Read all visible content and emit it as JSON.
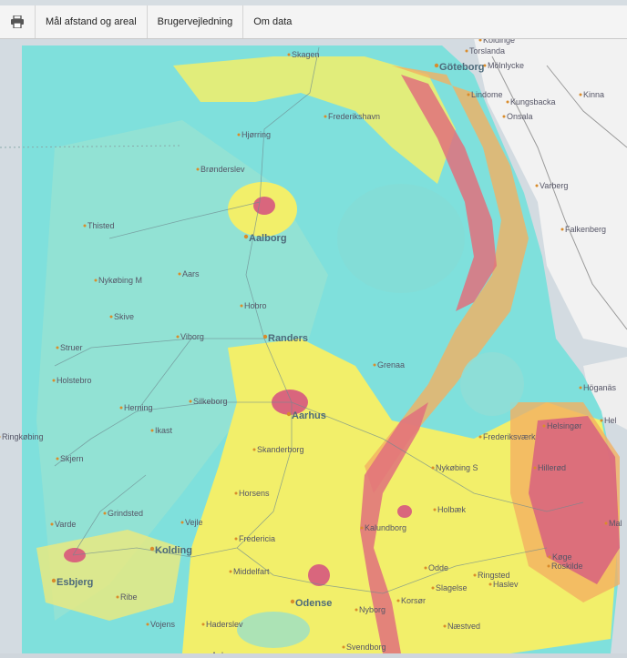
{
  "toolbar": {
    "print_icon": "printer-icon",
    "measure_label": "Mål afstand og areal",
    "guide_label": "Brugervejledning",
    "about_label": "Om data"
  },
  "map": {
    "cities": [
      {
        "name": "Göteborg",
        "major": true
      },
      {
        "name": "Torslanda",
        "major": false
      },
      {
        "name": "Mölnlycke",
        "major": false
      },
      {
        "name": "Lindome",
        "major": false
      },
      {
        "name": "Kungsbacka",
        "major": false
      },
      {
        "name": "Kinna",
        "major": false
      },
      {
        "name": "Onsala",
        "major": false
      },
      {
        "name": "Varberg",
        "major": false
      },
      {
        "name": "Falkenberg",
        "major": false
      },
      {
        "name": "Höganäs",
        "major": false
      },
      {
        "name": "Helsingør",
        "major": false
      },
      {
        "name": "Hel",
        "major": false
      },
      {
        "name": "Mal",
        "major": false
      },
      {
        "name": "Skagen",
        "major": false
      },
      {
        "name": "Frederikshavn",
        "major": false
      },
      {
        "name": "Hjørring",
        "major": false
      },
      {
        "name": "Brønderslev",
        "major": false
      },
      {
        "name": "Aalborg",
        "major": true
      },
      {
        "name": "Thisted",
        "major": false
      },
      {
        "name": "Nykøbing M",
        "major": false
      },
      {
        "name": "Aars",
        "major": false
      },
      {
        "name": "Hobro",
        "major": false
      },
      {
        "name": "Skive",
        "major": false
      },
      {
        "name": "Viborg",
        "major": false
      },
      {
        "name": "Randers",
        "major": true
      },
      {
        "name": "Struer",
        "major": false
      },
      {
        "name": "Holstebro",
        "major": false
      },
      {
        "name": "Grenaa",
        "major": false
      },
      {
        "name": "Herning",
        "major": false
      },
      {
        "name": "Silkeborg",
        "major": false
      },
      {
        "name": "Aarhus",
        "major": true
      },
      {
        "name": "Ringkøbing",
        "major": false
      },
      {
        "name": "Ikast",
        "major": false
      },
      {
        "name": "Skjern",
        "major": false
      },
      {
        "name": "Skanderborg",
        "major": false
      },
      {
        "name": "Frederiksværk",
        "major": false
      },
      {
        "name": "Hillerød",
        "major": false
      },
      {
        "name": "Nykøbing S",
        "major": false
      },
      {
        "name": "Horsens",
        "major": false
      },
      {
        "name": "Grindsted",
        "major": false
      },
      {
        "name": "Holbæk",
        "major": false
      },
      {
        "name": "Kalundborg",
        "major": false
      },
      {
        "name": "Vejle",
        "major": false
      },
      {
        "name": "Varde",
        "major": false
      },
      {
        "name": "Kolding",
        "major": true
      },
      {
        "name": "Fredericia",
        "major": false
      },
      {
        "name": "Esbjerg",
        "major": true
      },
      {
        "name": "Middelfart",
        "major": false
      },
      {
        "name": "Ringsted",
        "major": false
      },
      {
        "name": "Køge",
        "major": false
      },
      {
        "name": "Roskilde",
        "major": false
      },
      {
        "name": "Ribe",
        "major": false
      },
      {
        "name": "Odense",
        "major": true
      },
      {
        "name": "Slagelse",
        "major": false
      },
      {
        "name": "Haslev",
        "major": false
      },
      {
        "name": "Vojens",
        "major": false
      },
      {
        "name": "Haderslev",
        "major": false
      },
      {
        "name": "Nyborg",
        "major": false
      },
      {
        "name": "Korsør",
        "major": false
      },
      {
        "name": "Næstved",
        "major": false
      },
      {
        "name": "Aabenraa",
        "major": false
      },
      {
        "name": "Svendborg",
        "major": false
      },
      {
        "name": "Odde",
        "major": false
      },
      {
        "name": "Koldinge",
        "major": false
      }
    ]
  }
}
